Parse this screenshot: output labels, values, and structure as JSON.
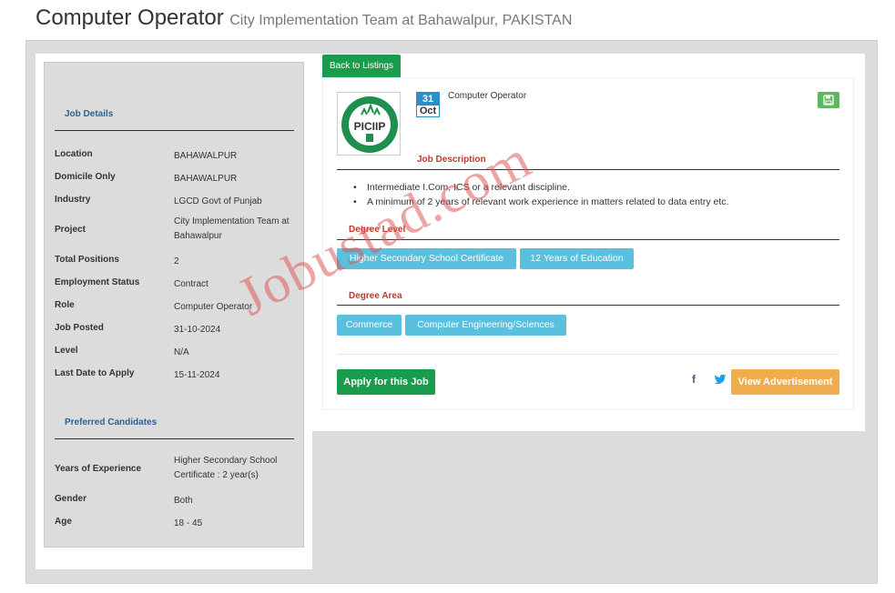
{
  "header": {
    "title": "Computer Operator",
    "subtitle": "City Implementation Team at Bahawalpur, PAKISTAN"
  },
  "job_details": {
    "section_title": "Job Details",
    "rows": [
      {
        "label": "Location",
        "value": "BAHAWALPUR"
      },
      {
        "label": "Domicile Only",
        "value": "BAHAWALPUR"
      },
      {
        "label": "Industry",
        "value": "LGCD Govt of Punjab"
      },
      {
        "label": "Project",
        "value": "City Implementation Team at Bahawalpur"
      },
      {
        "label": "Total Positions",
        "value": "2"
      },
      {
        "label": "Employment Status",
        "value": "Contract"
      },
      {
        "label": "Role",
        "value": "Computer Operator"
      },
      {
        "label": "Job Posted",
        "value": "31-10-2024"
      },
      {
        "label": "Level",
        "value": "N/A"
      },
      {
        "label": "Last Date to Apply",
        "value": "15-11-2024"
      }
    ]
  },
  "preferred": {
    "section_title": "Preferred Candidates",
    "rows": [
      {
        "label": "Years of Experience",
        "value": "Higher Secondary School Certificate : 2 year(s)"
      },
      {
        "label": "Gender",
        "value": "Both"
      },
      {
        "label": "Age",
        "value": "18 - 45"
      }
    ]
  },
  "buttons": {
    "back": "Back to Listings",
    "apply": "Apply for this Job",
    "advertisement": "View Advertisement"
  },
  "logo": {
    "text": "PICIIP",
    "color": "#1e8f4e"
  },
  "date": {
    "day": "31",
    "month": "Oct"
  },
  "job_title": "Computer Operator",
  "job_description": {
    "heading": "Job Description",
    "items": [
      "Intermediate I.Com, ICS or a relevant discipline.",
      "A minimum of 2 years of relevant work experience in matters related to data entry etc."
    ]
  },
  "degree_level": {
    "heading": "Degree Level",
    "tags": [
      "Higher Secondary School Certificate",
      "12 Years of Education"
    ]
  },
  "degree_area": {
    "heading": "Degree Area",
    "tags": [
      "Commerce",
      "Computer Engineering/Sciences"
    ]
  },
  "social": {
    "facebook": "f"
  },
  "watermark": "Jobustad.com",
  "colors": {
    "green": "#199c4c",
    "blue_tag": "#5bc0de",
    "orange": "#f0ad4e",
    "red_heading": "#c0392b",
    "link_blue": "#2a6496"
  }
}
